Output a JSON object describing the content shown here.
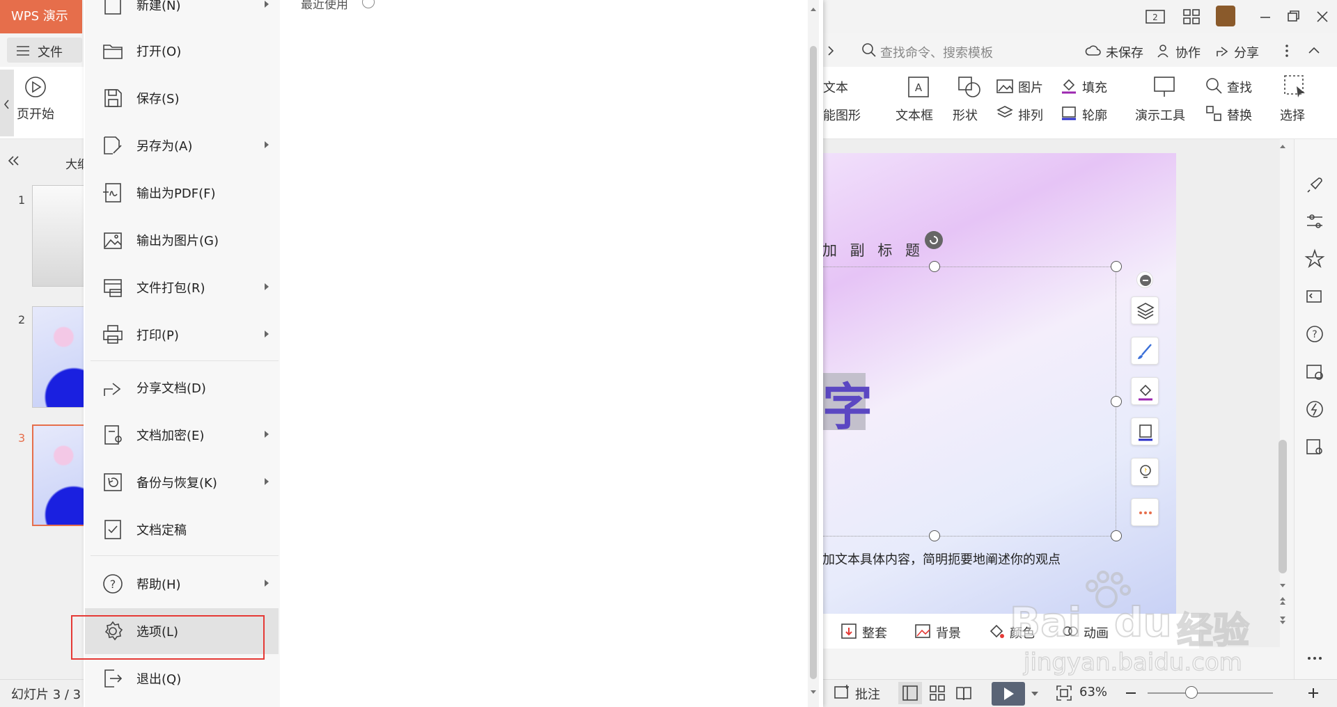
{
  "app": {
    "title": "WPS 演示"
  },
  "titlebar": {
    "page_badge": "2"
  },
  "menubar": {
    "file_label": "文件",
    "search_placeholder": "查找命令、搜索模板",
    "unsaved": "未保存",
    "collab": "协作",
    "share": "分享"
  },
  "ribbon": {
    "start_from_page": "页开始",
    "text_top": "文本",
    "smart_shape": "能图形",
    "text_box": "文本框",
    "shape": "形状",
    "picture": "图片",
    "arrange": "排列",
    "fill": "填充",
    "outline": "轮廓",
    "presenter_tools": "演示工具",
    "find": "查找",
    "replace": "替换",
    "select": "选择"
  },
  "left_panel": {
    "outline_tab": "大纲",
    "slides": [
      {
        "num": "1"
      },
      {
        "num": "2"
      },
      {
        "num": "3"
      }
    ]
  },
  "slide": {
    "subtitle": "加 副 标 题",
    "big_char": "字",
    "body": "加文本具体内容，简明扼要地阐述你的观点"
  },
  "bottom_toolbar": {
    "set": "整套",
    "background": "背景",
    "color": "颜色",
    "animation": "动画"
  },
  "statusbar": {
    "slide_counter": "幻灯片 3 / 3",
    "comment": "批注",
    "zoom": "63%"
  },
  "file_menu": {
    "recent": "最近使用",
    "items": {
      "new": "新建(N)",
      "open": "打开(O)",
      "save": "保存(S)",
      "save_as": "另存为(A)",
      "export_pdf": "输出为PDF(F)",
      "export_image": "输出为图片(G)",
      "package": "文件打包(R)",
      "print": "打印(P)",
      "share": "分享文档(D)",
      "encrypt": "文档加密(E)",
      "backup": "备份与恢复(K)",
      "finalize": "文档定稿",
      "help": "帮助(H)",
      "options": "选项(L)",
      "exit": "退出(Q)"
    }
  },
  "watermark": {
    "brand": "Bai",
    "brand_tail": "du",
    "cn": "经验",
    "url": "jingyan.baidu.com"
  },
  "colors": {
    "accent": "#e66e4b",
    "highlight": "#e53935",
    "slide_text": "#5b47c2"
  }
}
